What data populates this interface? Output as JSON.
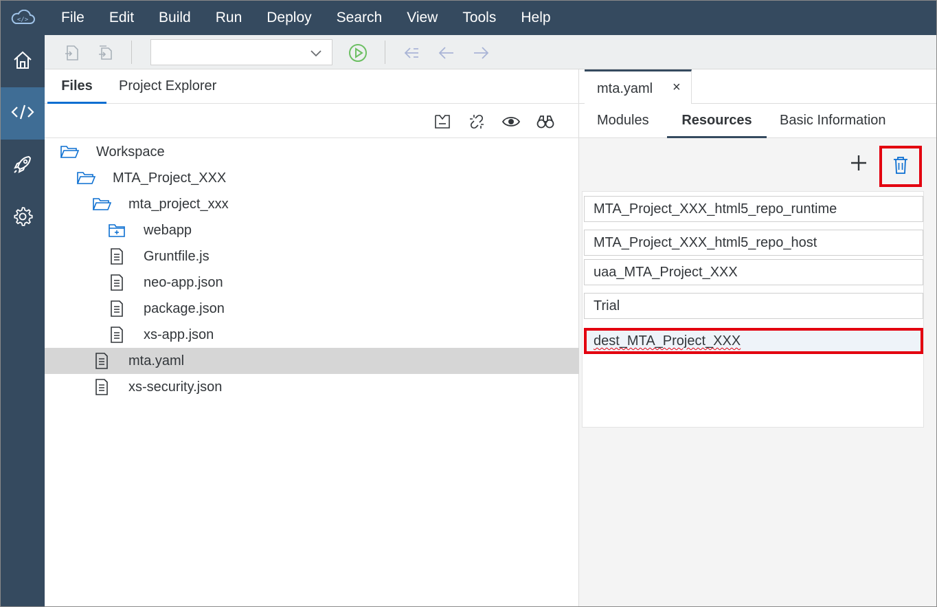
{
  "menubar": {
    "items": [
      "File",
      "Edit",
      "Build",
      "Run",
      "Deploy",
      "Search",
      "View",
      "Tools",
      "Help"
    ]
  },
  "toolbar": {
    "run_config_value": ""
  },
  "left_nav": {
    "items": [
      {
        "icon": "home-icon"
      },
      {
        "icon": "code-icon",
        "active": true
      },
      {
        "icon": "rocket-icon"
      },
      {
        "icon": "gear-icon"
      }
    ]
  },
  "file_pane": {
    "tabs": [
      {
        "label": "Files",
        "active": true
      },
      {
        "label": "Project Explorer",
        "active": false
      }
    ],
    "tree": [
      {
        "label": "Workspace",
        "type": "folder-open",
        "depth": 0
      },
      {
        "label": "MTA_Project_XXX",
        "type": "folder-open",
        "depth": 1
      },
      {
        "label": "mta_project_xxx",
        "type": "folder-open",
        "depth": 2
      },
      {
        "label": "webapp",
        "type": "folder-closed",
        "depth": 3
      },
      {
        "label": "Gruntfile.js",
        "type": "file",
        "depth": 3
      },
      {
        "label": "neo-app.json",
        "type": "file",
        "depth": 3
      },
      {
        "label": "package.json",
        "type": "file",
        "depth": 3
      },
      {
        "label": "xs-app.json",
        "type": "file",
        "depth": 3
      },
      {
        "label": "mta.yaml",
        "type": "file",
        "depth": 2,
        "selected": true
      },
      {
        "label": "xs-security.json",
        "type": "file",
        "depth": 2
      }
    ]
  },
  "editor": {
    "open_tab": {
      "label": "mta.yaml",
      "close": "×"
    },
    "sub_tabs": [
      {
        "label": "Modules",
        "active": false
      },
      {
        "label": "Resources",
        "active": true
      },
      {
        "label": "Basic Information",
        "active": false
      }
    ],
    "resources": [
      {
        "label": "MTA_Project_XXX_html5_repo_runtime"
      },
      {
        "label": "MTA_Project_XXX_html5_repo_host"
      },
      {
        "label": "uaa_MTA_Project_XXX"
      },
      {
        "label": "Trial"
      },
      {
        "label": "dest_MTA_Project_XXX",
        "selected": true
      }
    ]
  },
  "colors": {
    "shell": "#354a5f",
    "nav_active": "#3f6d95",
    "highlight": "#e3000f",
    "tab_accent": "#0a6ed1",
    "run_green": "#6cbf62"
  }
}
